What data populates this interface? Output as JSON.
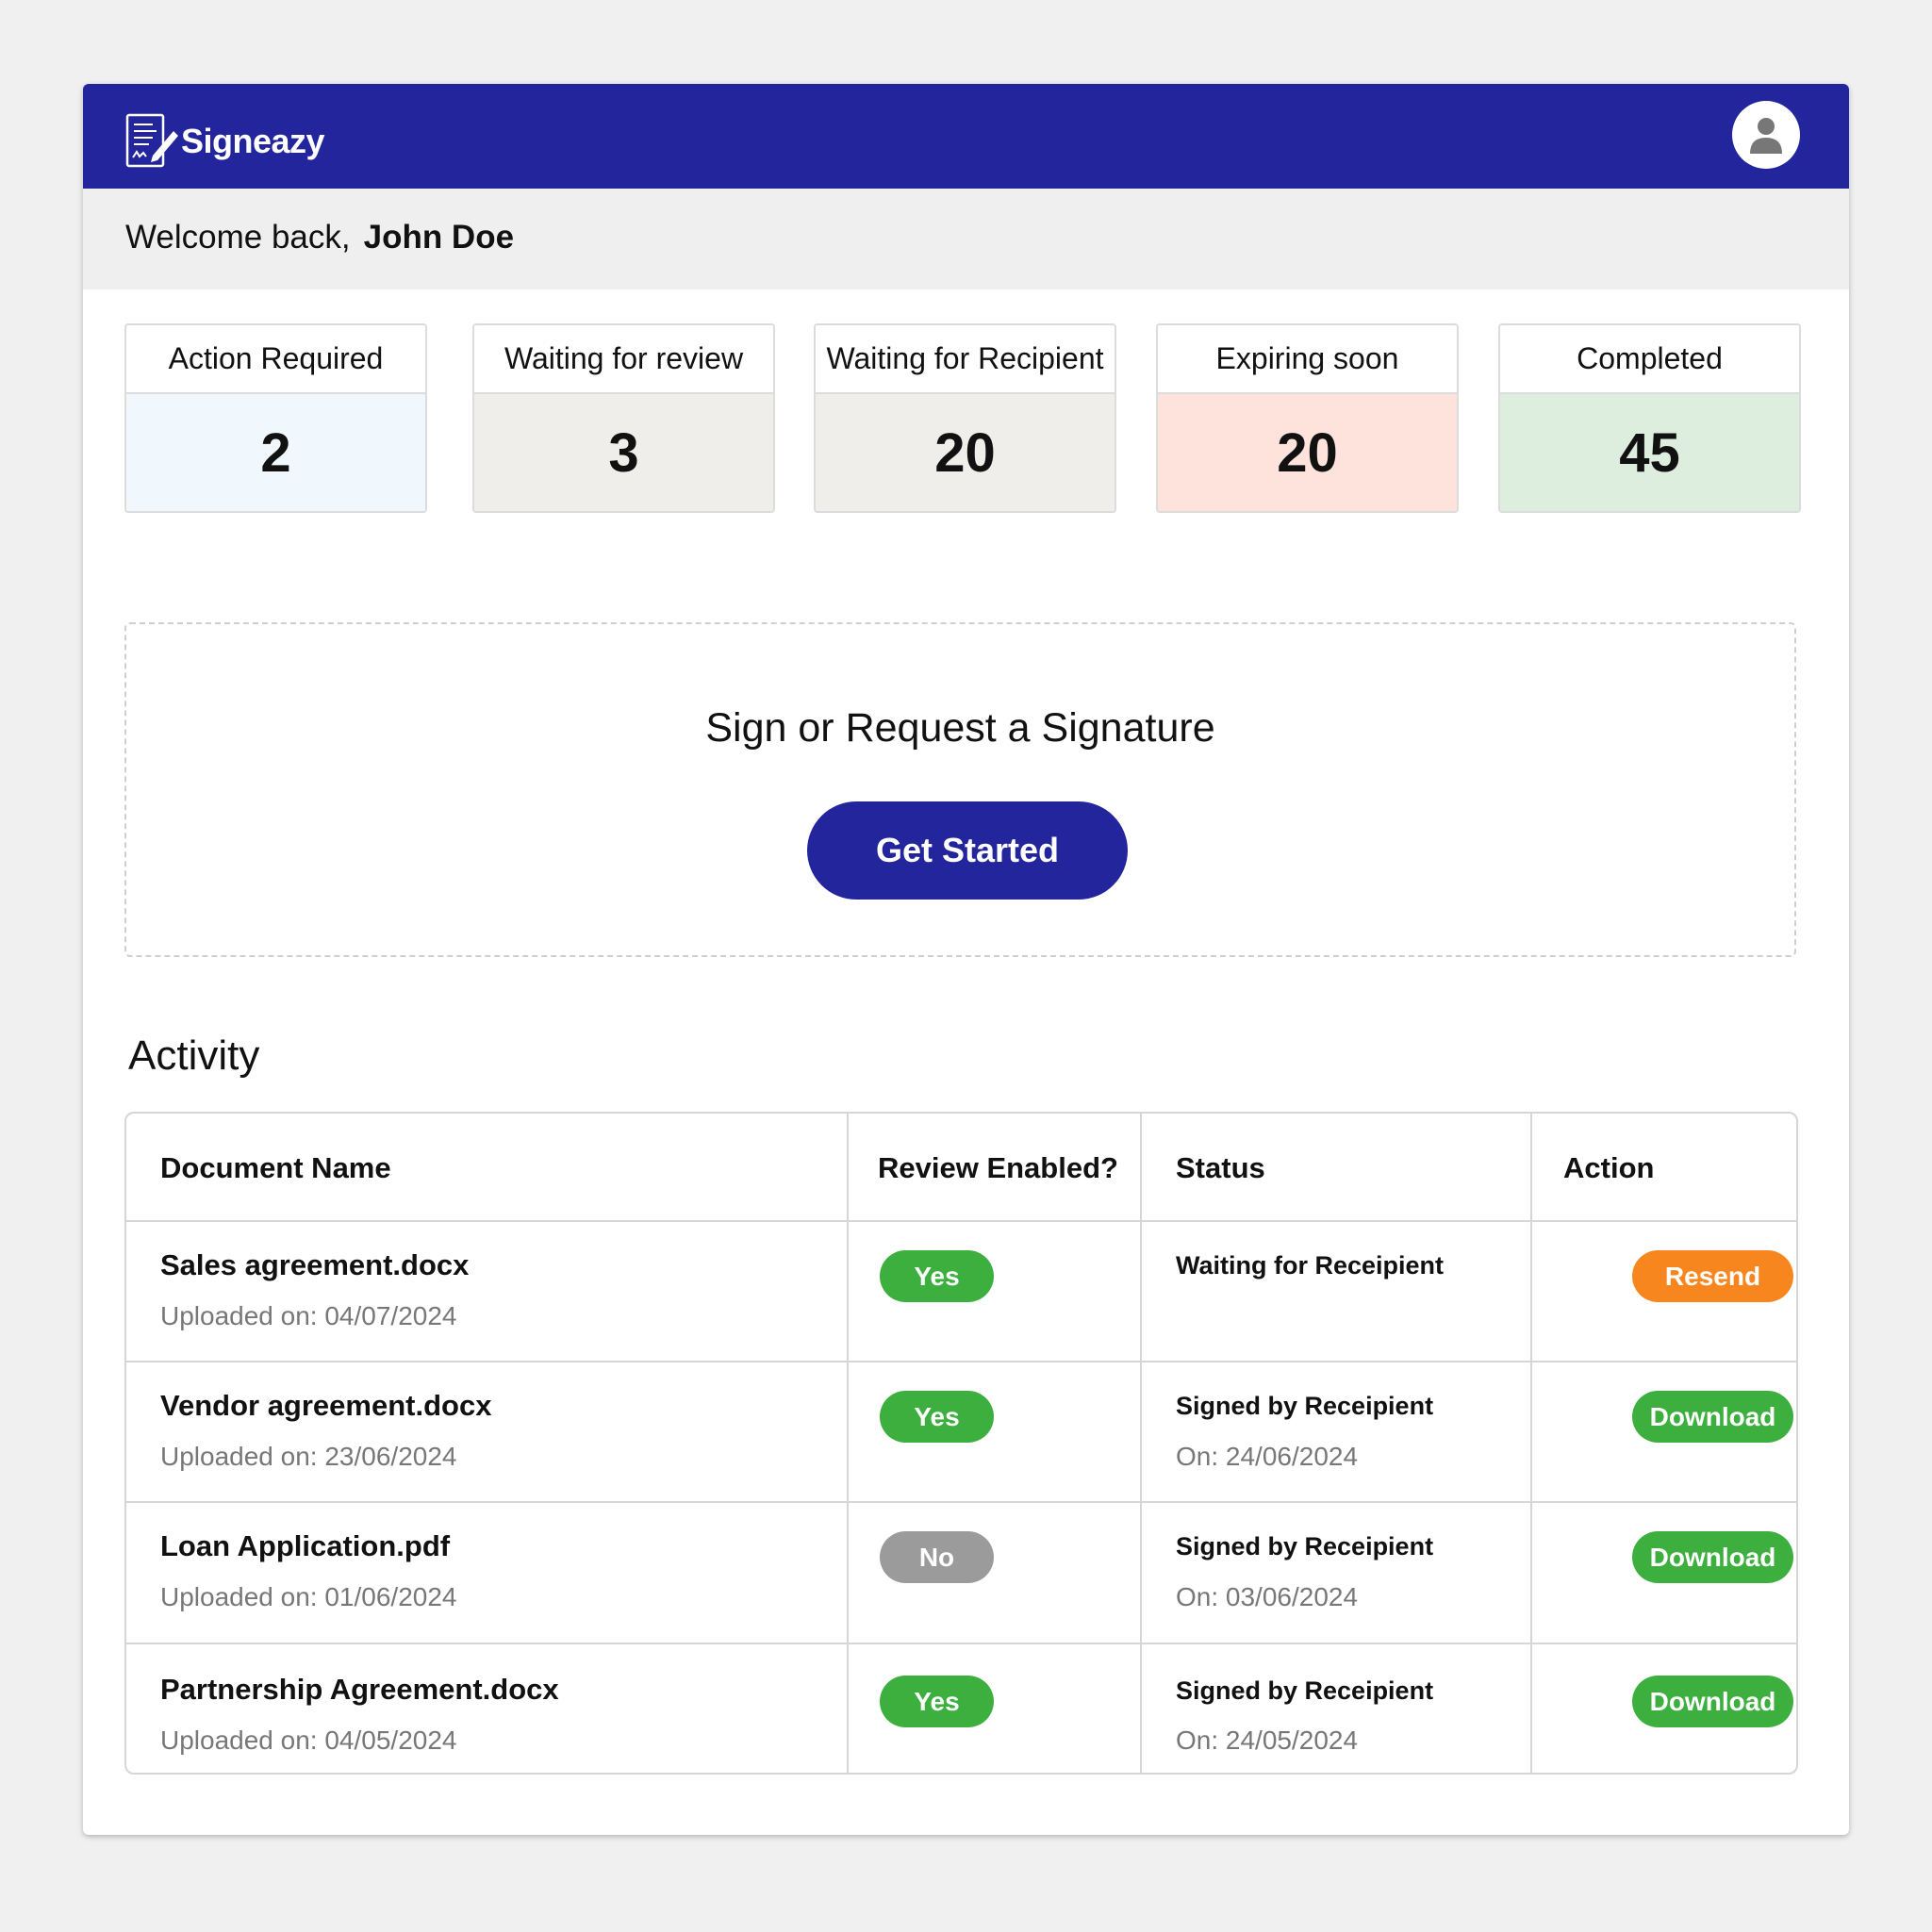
{
  "app": {
    "name": "Signeazy"
  },
  "welcome": {
    "greeting": "Welcome back,",
    "user_name": "John Doe"
  },
  "stats": [
    {
      "label": "Action Required",
      "value": "2",
      "color": "#f1f8fd"
    },
    {
      "label": "Waiting for review",
      "value": "3",
      "color": "#efeeea"
    },
    {
      "label": "Waiting for Recipient",
      "value": "20",
      "color": "#efeeea"
    },
    {
      "label": "Expiring soon",
      "value": "20",
      "color": "#fde3dc"
    },
    {
      "label": "Completed",
      "value": "45",
      "color": "#ddeedf"
    }
  ],
  "sign_box": {
    "title": "Sign or Request a Signature",
    "button_label": "Get Started"
  },
  "activity": {
    "title": "Activity",
    "columns": [
      "Document Name",
      "Review Enabled?",
      "Status",
      "Action"
    ],
    "rows": [
      {
        "name": "Sales agreement.docx",
        "uploaded": "Uploaded on: 04/07/2024",
        "review": "Yes",
        "status": "Waiting for Receipient",
        "status_date": "",
        "action": "Resend"
      },
      {
        "name": "Vendor agreement.docx",
        "uploaded": "Uploaded on: 23/06/2024",
        "review": "Yes",
        "status": "Signed by Receipient",
        "status_date": "On: 24/06/2024",
        "action": "Download"
      },
      {
        "name": "Loan Application.pdf",
        "uploaded": "Uploaded on: 01/06/2024",
        "review": "No",
        "status": "Signed by Receipient",
        "status_date": "On: 03/06/2024",
        "action": "Download"
      },
      {
        "name": "Partnership Agreement.docx",
        "uploaded": "Uploaded on: 04/05/2024",
        "review": "Yes",
        "status": "Signed by Receipient",
        "status_date": "On: 24/05/2024",
        "action": "Download"
      }
    ]
  },
  "colors": {
    "brand": "#23259c",
    "yes": "#3caf3f",
    "no": "#9b9b9b",
    "resend": "#f7861e",
    "download": "#3caf3f"
  }
}
